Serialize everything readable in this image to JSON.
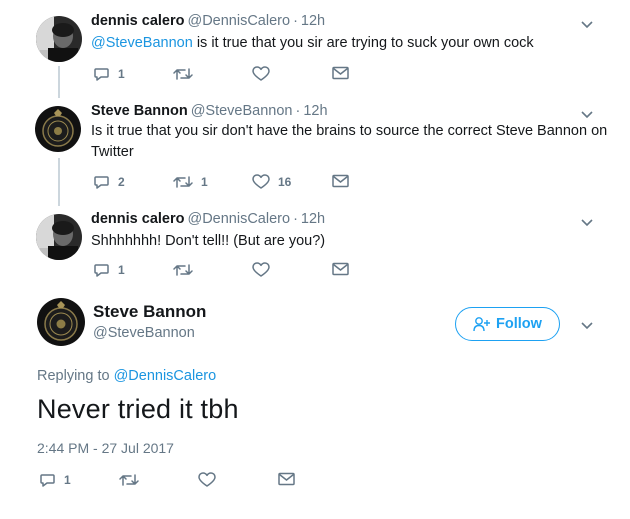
{
  "tweets": [
    {
      "name": "dennis calero",
      "handle": "@DennisCalero",
      "dot": "·",
      "time": "12h",
      "mention": "@SteveBannon",
      "text": " is it true that you sir are trying to suck your own cock",
      "replies": "1",
      "retweets": "",
      "likes": ""
    },
    {
      "name": "Steve Bannon",
      "handle": "@SteveBannon",
      "dot": "·",
      "time": "12h",
      "text": "Is it true that you sir don't have the brains to source the correct Steve Bannon on Twitter",
      "replies": "2",
      "retweets": "1",
      "likes": "16"
    },
    {
      "name": "dennis calero",
      "handle": "@DennisCalero",
      "dot": "·",
      "time": "12h",
      "text": "Shhhhhhh! Don't tell!! (But are you?)",
      "replies": "1",
      "retweets": "",
      "likes": ""
    }
  ],
  "main": {
    "name": "Steve Bannon",
    "handle": "@SteveBannon",
    "follow_label": "Follow",
    "replying_prefix": "Replying to ",
    "replying_to": "@DennisCalero",
    "text": "Never tried it tbh",
    "timestamp": "2:44 PM - 27 Jul 2017",
    "replies": "1"
  },
  "colors": {
    "accent": "#1da1f2",
    "mention": "#1b95e0",
    "muted": "#657786",
    "thread_line": "#ccd6dd"
  },
  "icons": [
    "reply-icon",
    "retweet-icon",
    "like-icon",
    "dm-icon",
    "chevron-down-icon",
    "follow-person-icon"
  ]
}
